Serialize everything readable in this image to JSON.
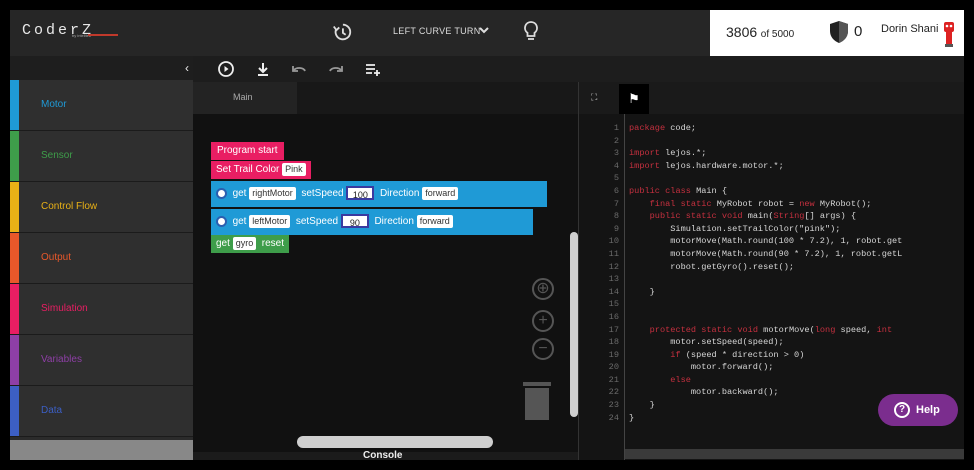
{
  "header": {
    "logo": "CoderZ",
    "logo_sub": "by intelitek",
    "mission": "LEFT CURVE TURN",
    "score_value": "3806",
    "score_of": "of 5000",
    "shield_count": "0",
    "user_name": "Dorin Shani"
  },
  "sidebar": {
    "categories": [
      {
        "label": "Motor",
        "color": "#1f9ad6"
      },
      {
        "label": "Sensor",
        "color": "#3e9d4a"
      },
      {
        "label": "Control Flow",
        "color": "#e9b116"
      },
      {
        "label": "Output",
        "color": "#e8582a"
      },
      {
        "label": "Simulation",
        "color": "#e91e63"
      },
      {
        "label": "Variables",
        "color": "#8e3fa6"
      },
      {
        "label": "Data",
        "color": "#3c5fc4"
      }
    ]
  },
  "workspace": {
    "tab": "Main",
    "blocks": {
      "program_start": "Program start",
      "trail_label": "Set Trail Color",
      "trail_value": "Pink",
      "get1": "get",
      "motor1": "rightMotor",
      "setspeed1": "setSpeed",
      "speed1": "100",
      "dir1_label": "Direction",
      "dir1_value": "forward",
      "get2": "get",
      "motor2": "leftMotor",
      "setspeed2": "setSpeed",
      "speed2": "90",
      "dir2_label": "Direction",
      "dir2_value": "forward",
      "get3": "get",
      "sensor3": "gyro",
      "reset3": "reset"
    }
  },
  "console_label": "Console",
  "code": {
    "line_numbers": [
      "1",
      "2",
      "3",
      "4",
      "5",
      "6",
      "7",
      "8",
      "9",
      "10",
      "11",
      "12",
      "13",
      "14",
      "15",
      "16",
      "17",
      "18",
      "19",
      "20",
      "21",
      "22",
      "23",
      "24"
    ],
    "lines": [
      "package code;",
      "",
      "import lejos.*;",
      "import lejos.hardware.motor.*;",
      "",
      "public class Main {",
      "    final static MyRobot robot = new MyRobot();",
      "    public static void main(String[] args) {",
      "        Simulation.setTrailColor(\"pink\");",
      "        motorMove(Math.round(100 * 7.2), 1, robot.get",
      "        motorMove(Math.round(90 * 7.2), 1, robot.getL",
      "        robot.getGyro().reset();",
      "",
      "    }",
      "",
      "",
      "    protected static void motorMove(long speed, int",
      "        motor.setSpeed(speed);",
      "        if (speed * direction > 0)",
      "            motor.forward();",
      "        else",
      "            motor.backward();",
      "    }",
      "}"
    ]
  },
  "help_label": "Help"
}
